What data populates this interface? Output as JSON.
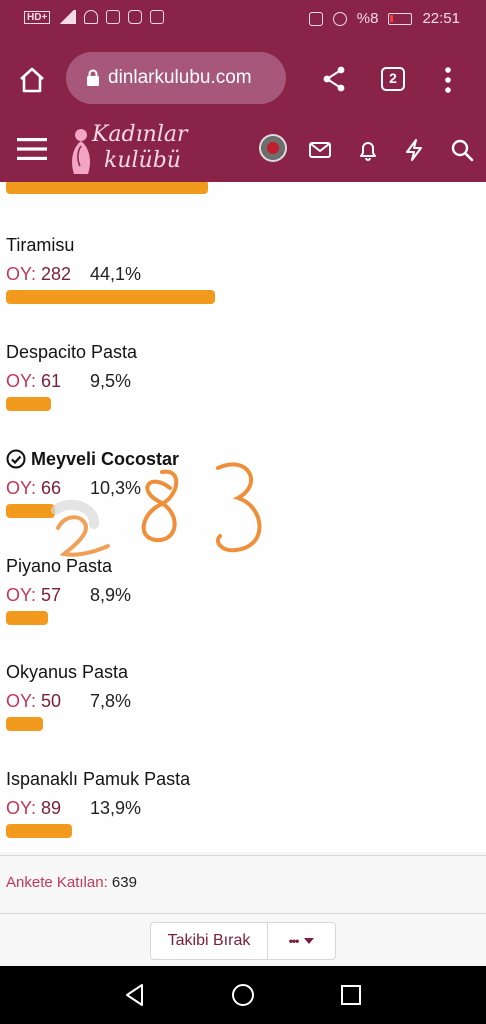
{
  "status_bar": {
    "hd_label": "HD+",
    "battery": "%8",
    "time": "22:51"
  },
  "browser": {
    "url": "dinlarkulubu.com",
    "tab_count": "2"
  },
  "site": {
    "logo_line1": "Kadınlar",
    "logo_line2": "kulübü"
  },
  "poll": {
    "vote_label": "OY:",
    "options": [
      {
        "name": "Tiramisu",
        "votes": "282",
        "percent": "44,1%",
        "fraction": 0.441,
        "bold": false
      },
      {
        "name": "Despacito Pasta",
        "votes": "61",
        "percent": "9,5%",
        "fraction": 0.095,
        "bold": false
      },
      {
        "name": "Meyveli Cocostar",
        "votes": "66",
        "percent": "10,3%",
        "fraction": 0.103,
        "bold": true
      },
      {
        "name": "Piyano Pasta",
        "votes": "57",
        "percent": "8,9%",
        "fraction": 0.089,
        "bold": false
      },
      {
        "name": "Okyanus Pasta",
        "votes": "50",
        "percent": "7,8%",
        "fraction": 0.078,
        "bold": false
      },
      {
        "name": "Ispanaklı Pamuk Pasta",
        "votes": "89",
        "percent": "13,9%",
        "fraction": 0.139,
        "bold": false
      }
    ],
    "participants_label": "Ankete Katılan:",
    "participants": "639"
  },
  "handwriting": "283",
  "actions": {
    "unfollow_label": "Takibi Bırak",
    "more_label": "•••"
  },
  "colors": {
    "brand": "#8a2348",
    "bar": "#f29a1e",
    "vote_label": "#c0385a"
  },
  "icons": [
    "home-icon",
    "lock-icon",
    "share-icon",
    "more-vert-icon",
    "menu-icon",
    "mail-icon",
    "bell-icon",
    "bolt-icon",
    "search-icon",
    "check-circle-icon",
    "back-icon",
    "home-circle-icon",
    "recents-icon"
  ]
}
